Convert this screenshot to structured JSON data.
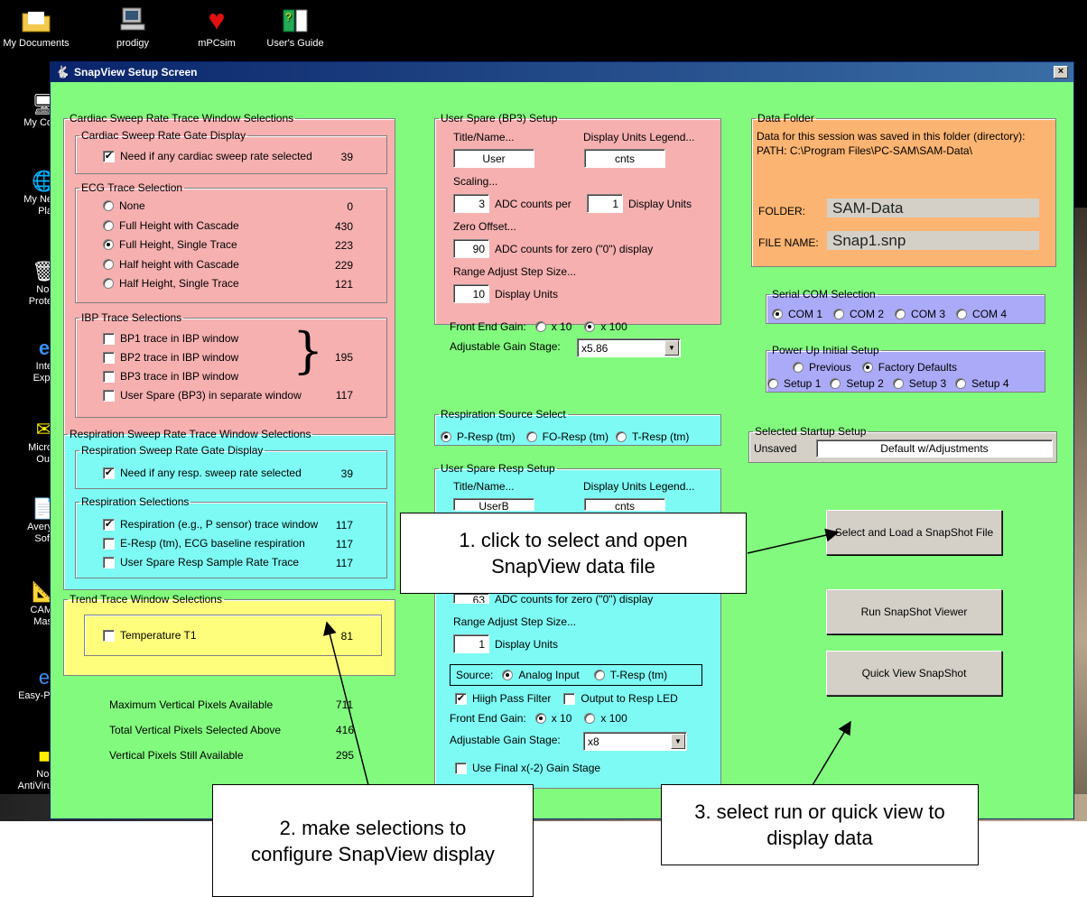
{
  "desktop": {
    "top_icons": [
      "My Documents",
      "prodigy",
      "mPCsim",
      "User's Guide"
    ],
    "left_icons": [
      {
        "line1": "My Co",
        "line2": ""
      },
      {
        "line1": "My Ne",
        "line2": "Pla"
      },
      {
        "line1": "Nor",
        "line2": "Prote"
      },
      {
        "line1": "Inte",
        "line2": "Expl"
      },
      {
        "line1": "Micro",
        "line2": "Out"
      },
      {
        "line1": "Avery",
        "line2": "Soft"
      },
      {
        "line1": "CAM",
        "line2": "Mas"
      },
      {
        "line1": "Easy-Pl",
        "line2": ""
      },
      {
        "line1": "Nor",
        "line2": "AntiViru"
      }
    ]
  },
  "window": {
    "title": "SnapView Setup Screen",
    "close": "×"
  },
  "cardiac": {
    "legend": "Cardiac Sweep Rate Trace Window Selections",
    "gate": {
      "legend": "Cardiac Sweep Rate Gate Display",
      "label": "Need if any cardiac sweep rate selected",
      "value": "39",
      "checked": "✔"
    },
    "ecg": {
      "legend": "ECG Trace Selection",
      "options": [
        {
          "label": "None",
          "value": "0"
        },
        {
          "label": "Full Height with Cascade",
          "value": "430"
        },
        {
          "label": "Full Height, Single Trace",
          "value": "223"
        },
        {
          "label": "Half height with Cascade",
          "value": "229"
        },
        {
          "label": "Half Height, Single Trace",
          "value": "121"
        }
      ],
      "selected_index": 2
    },
    "ibp": {
      "legend": "IBP Trace Selections",
      "items": [
        "BP1 trace in IBP window",
        "BP2 trace in IBP window",
        "BP3 trace in IBP window",
        "User Spare (BP3) in separate window"
      ],
      "brace": "}",
      "group_value": "195",
      "separate_value": "117"
    }
  },
  "respiration": {
    "legend": "Respiration Sweep Rate Trace Window Selections",
    "gate": {
      "legend": "Respiration Sweep Rate Gate Display",
      "label": "Need if any resp. sweep rate selected",
      "value": "39",
      "checked": "✔"
    },
    "selections": {
      "legend": "Respiration Selections",
      "items": [
        {
          "label": "Respiration (e.g., P sensor) trace window",
          "value": "117",
          "checked": "✔"
        },
        {
          "label": "E-Resp (tm), ECG baseline respiration",
          "value": "117",
          "checked": ""
        },
        {
          "label": "User Spare Resp Sample Rate Trace",
          "value": "117",
          "checked": ""
        }
      ]
    }
  },
  "trend": {
    "legend": "Trend Trace Window Selections",
    "item": {
      "label": "Temperature T1",
      "value": "81"
    }
  },
  "pixels": [
    {
      "label": "Maximum Vertical Pixels Available",
      "value": "711"
    },
    {
      "label": "Total Vertical Pixels Selected Above",
      "value": "416"
    },
    {
      "label": "Vertical Pixels Still Available",
      "value": "295"
    }
  ],
  "user_spare_bp3": {
    "legend": "User Spare (BP3) Setup",
    "title_label": "Title/Name...",
    "units_label": "Display Units Legend...",
    "title_value": "User",
    "units_value": "cnts",
    "scaling_label": "Scaling...",
    "adc_value": "3",
    "adc_text": "ADC counts per",
    "disp_value": "1",
    "disp_text": "Display Units",
    "zero_label": "Zero Offset...",
    "zero_value": "90",
    "zero_text": "ADC counts for zero (\"0\") display",
    "range_label": "Range Adjust Step Size...",
    "range_value": "10",
    "range_text": "Display Units",
    "gain_label": "Front End Gain:",
    "gain_opt1": "x 10",
    "gain_opt2": "x 100",
    "adj_label": "Adjustable Gain Stage:",
    "adj_value": "x5.86"
  },
  "resp_source": {
    "legend": "Respiration Source Select",
    "options": [
      "P-Resp (tm)",
      "FO-Resp (tm)",
      "T-Resp (tm)"
    ]
  },
  "user_spare_resp": {
    "legend": "User Spare Resp Setup",
    "title_label": "Title/Name...",
    "units_label": "Display Units Legend...",
    "title_value": "UserB",
    "units_value": "cnts",
    "zero_value": "63",
    "zero_text": "ADC counts for zero (\"0\") display",
    "range_label": "Range Adjust Step Size...",
    "range_value": "1",
    "range_text": "Display Units",
    "source_label": "Source:",
    "source_opt1": "Analog Input",
    "source_opt2": "T-Resp (tm)",
    "hpf_label": "Hiigh Pass Filter",
    "led_label": "Output to Resp LED",
    "gain_label": "Front End Gain:",
    "gain_opt1": "x 10",
    "gain_opt2": "x 100",
    "adj_label": "Adjustable Gain Stage:",
    "adj_value": "x8",
    "final_label": "Use Final x(-2) Gain Stage"
  },
  "data_folder": {
    "legend": "Data Folder",
    "line1": "Data for this session was saved in this folder (directory):",
    "path": "PATH:   C:\\Program Files\\PC-SAM\\SAM-Data\\",
    "folder_label": "FOLDER:",
    "folder_value": "SAM-Data",
    "file_label": "FILE NAME:",
    "file_value": "Snap1.snp"
  },
  "serial": {
    "legend": "Serial COM Selection",
    "options": [
      "COM 1",
      "COM 2",
      "COM 3",
      "COM 4"
    ]
  },
  "powerup": {
    "legend": "Power Up Initial Setup",
    "options": [
      "Previous",
      "Factory Defaults",
      "Setup 1",
      "Setup 2",
      "Setup 3",
      "Setup 4"
    ]
  },
  "startup": {
    "legend": "Selected Startup Setup",
    "status": "Unsaved",
    "value": "Default w/Adjustments"
  },
  "buttons": {
    "select_load": "Select and Load a SnapShot File",
    "run_viewer": "Run SnapShot Viewer",
    "quick_view": "Quick View SnapShot"
  },
  "callouts": {
    "c1": "1. click to select and open SnapView data file",
    "c2": "2. make selections to configure SnapView display",
    "c3": "3. select run or quick view to display data"
  }
}
